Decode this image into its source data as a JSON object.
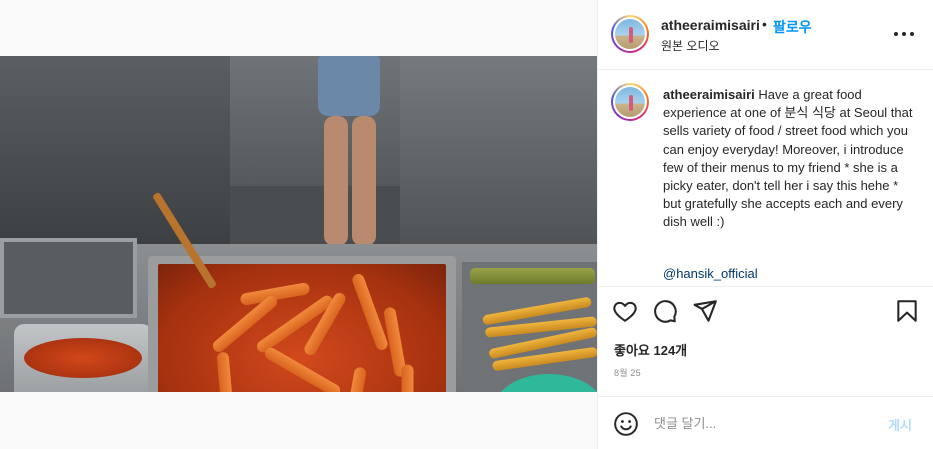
{
  "post": {
    "username": "atheeraimisairi",
    "dot": "•",
    "follow_label": "팔로우",
    "audio_label": "원본 오디오",
    "caption_text": "Have a great food experience at one of 분식 식당 at Seoul that sells variety of food / street food which you can enjoy everyday! Moreover, i introduce few of their menus to my friend * she is a picky eater, don't tell her i say this hehe * but gratefully she accepts each and every dish well :)",
    "mention": "@hansik_official",
    "likes_label": "좋아요 124개",
    "date_label": "8월 25"
  },
  "comment": {
    "placeholder": "댓글 달기...",
    "post_label": "게시"
  },
  "icons": {
    "more": "more-options-icon",
    "like": "heart-icon",
    "comment": "comment-bubble-icon",
    "share": "paper-plane-icon",
    "save": "bookmark-icon",
    "emoji": "smiley-icon",
    "mute": "speaker-icon"
  },
  "colors": {
    "follow": "#0095f6",
    "mention": "#00376b",
    "post_disabled": "#b3dbff",
    "muted_text": "#8e8e8e"
  }
}
